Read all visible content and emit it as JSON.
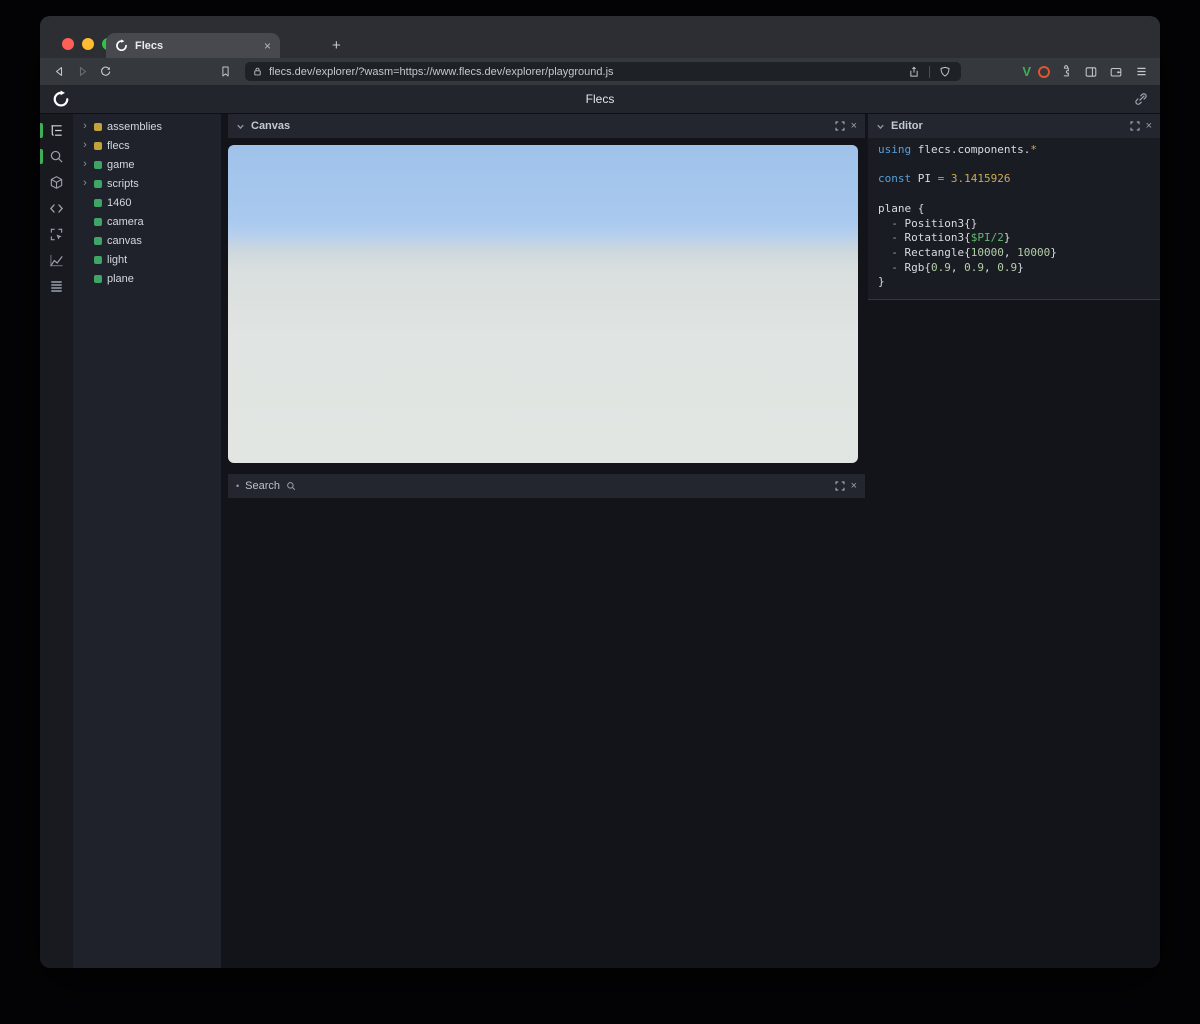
{
  "colors": {
    "accent_green": "#3fae57",
    "module_yellow": "#c2a23a",
    "entity_green": "#3fa564"
  },
  "icons": {
    "close": "×",
    "plus": "+",
    "chevron_right": "›",
    "bullet": "•"
  },
  "browser": {
    "tab_title": "Flecs",
    "url": "flecs.dev/explorer/?wasm=https://www.flecs.dev/explorer/playground.js",
    "extension_v": "V"
  },
  "app": {
    "title": "Flecs"
  },
  "tree": {
    "items": [
      {
        "label": "assemblies",
        "type": "module",
        "expandable": true
      },
      {
        "label": "flecs",
        "type": "module",
        "expandable": true
      },
      {
        "label": "game",
        "type": "entity",
        "expandable": true
      },
      {
        "label": "scripts",
        "type": "entity",
        "expandable": true
      },
      {
        "label": "1460",
        "type": "entity",
        "expandable": false
      },
      {
        "label": "camera",
        "type": "entity",
        "expandable": false
      },
      {
        "label": "canvas",
        "type": "entity",
        "expandable": false
      },
      {
        "label": "light",
        "type": "entity",
        "expandable": false
      },
      {
        "label": "plane",
        "type": "entity",
        "expandable": false
      }
    ]
  },
  "panels": {
    "canvas": {
      "title": "Canvas"
    },
    "search": {
      "title": "Search"
    },
    "editor": {
      "title": "Editor"
    }
  },
  "code": {
    "lines": [
      [
        {
          "t": "using ",
          "c": "kw"
        },
        {
          "t": "flecs.components.",
          "c": "plain"
        },
        {
          "t": "*",
          "c": "gold"
        }
      ],
      [],
      [
        {
          "t": "const ",
          "c": "kw"
        },
        {
          "t": "PI",
          "c": "plain"
        },
        {
          "t": " = ",
          "c": "dim"
        },
        {
          "t": "3.1415926",
          "c": "gold"
        }
      ],
      [],
      [
        {
          "t": "plane {",
          "c": "plain"
        }
      ],
      [
        {
          "t": "  - ",
          "c": "dim"
        },
        {
          "t": "Position3{}",
          "c": "plain"
        }
      ],
      [
        {
          "t": "  - ",
          "c": "dim"
        },
        {
          "t": "Rotation3{",
          "c": "plain"
        },
        {
          "t": "$PI/2",
          "c": "green"
        },
        {
          "t": "}",
          "c": "plain"
        }
      ],
      [
        {
          "t": "  - ",
          "c": "dim"
        },
        {
          "t": "Rectangle{",
          "c": "plain"
        },
        {
          "t": "10000",
          "c": "num"
        },
        {
          "t": ", ",
          "c": "plain"
        },
        {
          "t": "10000",
          "c": "num"
        },
        {
          "t": "}",
          "c": "plain"
        }
      ],
      [
        {
          "t": "  - ",
          "c": "dim"
        },
        {
          "t": "Rgb{",
          "c": "plain"
        },
        {
          "t": "0.9",
          "c": "num"
        },
        {
          "t": ", ",
          "c": "plain"
        },
        {
          "t": "0.9",
          "c": "num"
        },
        {
          "t": ", ",
          "c": "plain"
        },
        {
          "t": "0.9",
          "c": "num"
        },
        {
          "t": "}",
          "c": "plain"
        }
      ],
      [
        {
          "t": "}",
          "c": "plain"
        }
      ]
    ]
  }
}
